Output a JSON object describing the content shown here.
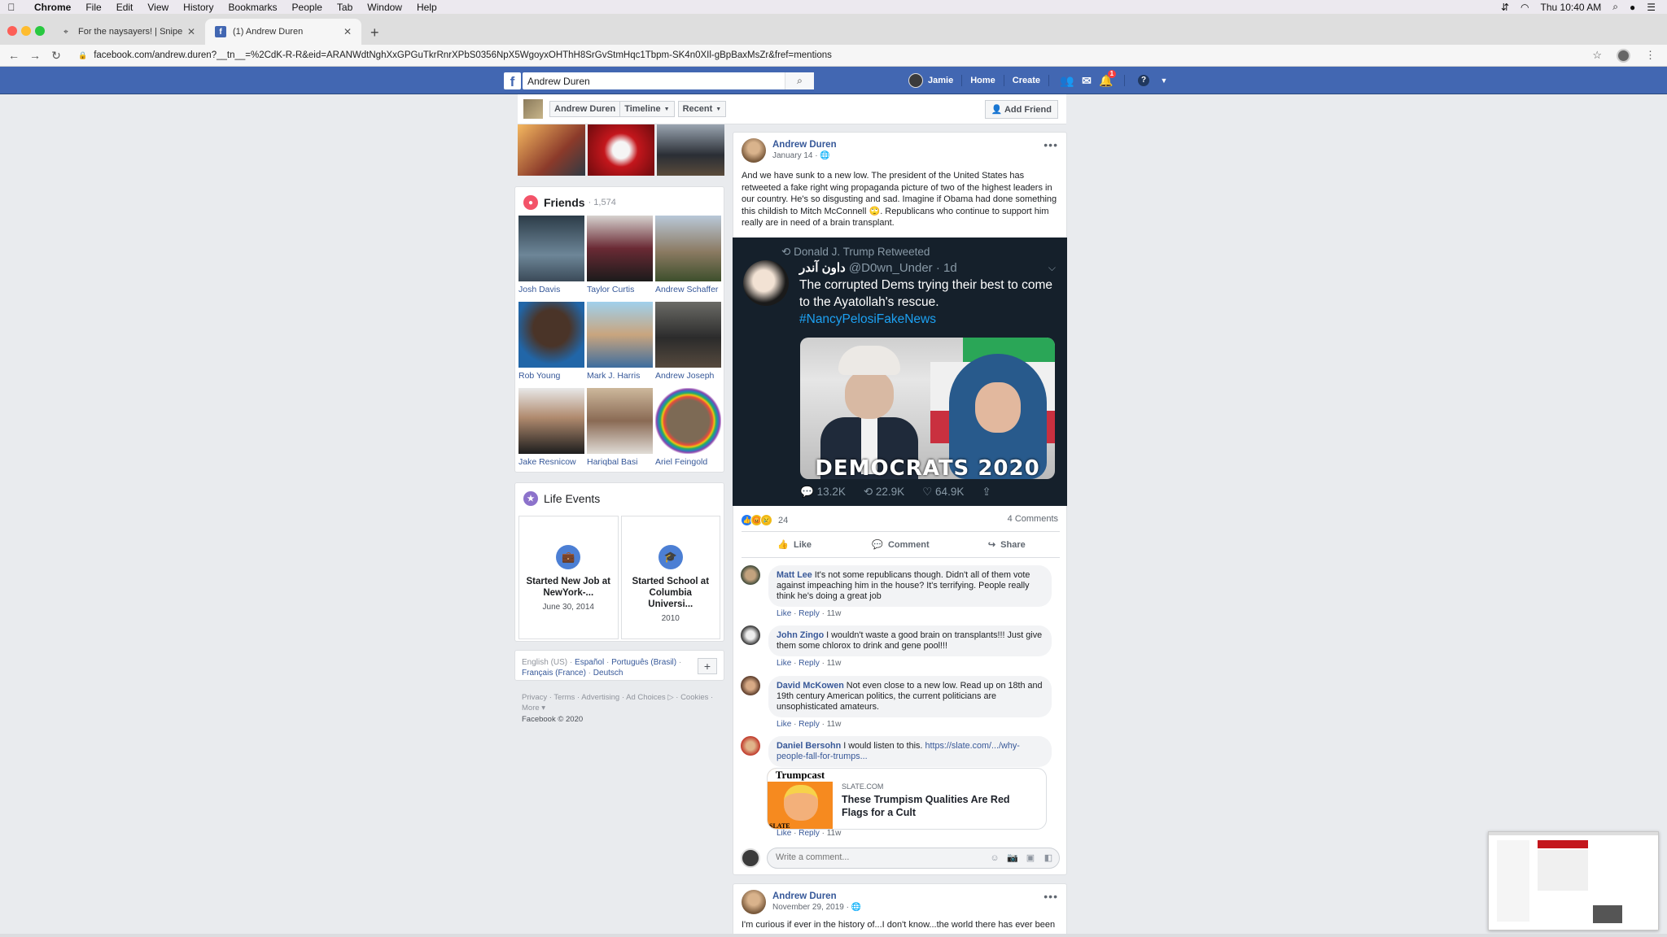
{
  "menubar": {
    "app": "Chrome",
    "items": [
      "File",
      "Edit",
      "View",
      "History",
      "Bookmarks",
      "People",
      "Tab",
      "Window",
      "Help"
    ],
    "clock": "Thu 10:40 AM"
  },
  "tabs": [
    {
      "title": "For the naysayers! | Sniper's Hid",
      "active": false
    },
    {
      "title": "(1) Andrew Duren",
      "active": true
    }
  ],
  "address": {
    "url": "facebook.com/andrew.duren?__tn__=%2CdK-R-R&eid=ARANWdtNghXxGPGuTkrRnrXPbS0356NpX5WgoyxOHThH8SrGvStmHqc1Tbpm-SK4n0XIl-gBpBaxMsZr&fref=mentions"
  },
  "fb": {
    "search_value": "Andrew Duren",
    "user_name": "Jamie",
    "nav_home": "Home",
    "nav_create": "Create",
    "notif_badge": "1",
    "brand_color": "#4267b2"
  },
  "profile_header": {
    "name": "Andrew Duren",
    "timeline": "Timeline",
    "recent": "Recent",
    "add_friend": "Add Friend"
  },
  "friends": {
    "title": "Friends",
    "count": "· 1,574",
    "list": [
      {
        "name": "Josh Davis"
      },
      {
        "name": "Taylor Curtis"
      },
      {
        "name": "Andrew Schaffer"
      },
      {
        "name": "Rob Young"
      },
      {
        "name": "Mark J. Harris"
      },
      {
        "name": "Andrew Joseph"
      },
      {
        "name": "Jake Resnicow"
      },
      {
        "name": "Hariqbal Basi"
      },
      {
        "name": "Ariel Feingold"
      }
    ]
  },
  "life_events": {
    "title": "Life Events",
    "events": [
      {
        "title": "Started New Job at NewYork-...",
        "date": "June 30, 2014"
      },
      {
        "title": "Started School at Columbia Universi...",
        "date": "2010"
      }
    ]
  },
  "languages": {
    "current": "English (US)",
    "others": [
      "Español",
      "Português (Brasil)",
      "Français (France)",
      "Deutsch"
    ]
  },
  "footer": {
    "links": "Privacy · Terms · Advertising · Ad Choices ▷ · Cookies · More ▾",
    "copyright": "Facebook © 2020"
  },
  "post": {
    "author": "Andrew Duren",
    "date": "January 14 ·",
    "text": "And we have sunk to a new low. The president of the United States has retweeted a fake right wing propaganda picture of two of the highest leaders in our country. He's so disgusting and sad. Imagine if Obama had done something this childish to Mitch McConnell 🙄. Republicans who continue to support him really are in need of a brain transplant.",
    "tweet": {
      "retweeted_by": "Donald J. Trump Retweeted",
      "display_name": "داون آندر",
      "handle": "@D0wn_Under · 1d",
      "text": "The corrupted Dems trying their best to come to the Ayatollah's rescue.",
      "hashtag": "#NancyPelosiFakeNews",
      "image_caption": "DEMOCRATS 2020",
      "replies": "13.2K",
      "retweets": "22.9K",
      "likes": "64.9K"
    },
    "reaction_count": "24",
    "comments_count": "4 Comments",
    "actions": {
      "like": "Like",
      "comment": "Comment",
      "share": "Share"
    },
    "comments": [
      {
        "name": "Matt Lee",
        "text": "It's not some republicans though. Didn't all of them vote against impeaching him in the house? It's terrifying. People really think he's doing a great job",
        "age": "11w"
      },
      {
        "name": "John Zingo",
        "text": "I wouldn't waste a good brain on transplants!!! Just give them some chlorox to drink and gene pool!!!",
        "age": "11w"
      },
      {
        "name": "David McKowen",
        "text": "Not even close to a new low. Read up on 18th and 19th century American politics, the current politicians are unsophisticated amateurs.",
        "age": "11w"
      },
      {
        "name": "Daniel Bersohn",
        "text": "I would listen to this.",
        "link": "https://slate.com/.../why-people-fall-for-trumps...",
        "age": "11w"
      }
    ],
    "link_preview": {
      "domain": "SLATE.COM",
      "title": "These Trumpism Qualities Are Red Flags for a Cult",
      "image_title": "Trumpcast",
      "image_brand": "SLATE"
    },
    "comment_meta": {
      "like": "Like",
      "reply": "Reply"
    },
    "write_placeholder": "Write a comment..."
  },
  "post2": {
    "author": "Andrew Duren",
    "date": "November 29, 2019 ·",
    "text": "I'm curious if ever in the history of...I don't know...the world there has ever been"
  }
}
